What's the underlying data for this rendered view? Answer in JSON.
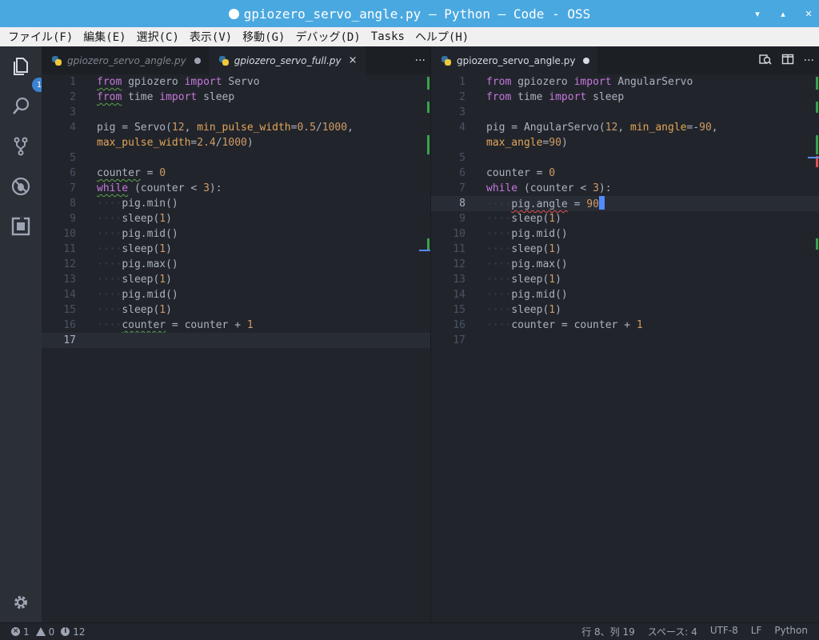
{
  "window": {
    "title": "gpiozero_servo_angle.py — Python — Code - OSS",
    "controls": [
      "▾",
      "▴",
      "✕"
    ]
  },
  "menu": [
    "ファイル(F)",
    "編集(E)",
    "選択(C)",
    "表示(V)",
    "移動(G)",
    "デバッグ(D)",
    "Tasks",
    "ヘルプ(H)"
  ],
  "activity": {
    "explorer_badge": "1"
  },
  "left_group": {
    "tabs": [
      {
        "label": "gpiozero_servo_angle.py",
        "dirty": true
      },
      {
        "label": "gpiozero_servo_full.py",
        "close": "×"
      }
    ],
    "more": "···",
    "line_numbers": [
      "1",
      "2",
      "3",
      "4",
      "",
      "5",
      "6",
      "7",
      "8",
      "9",
      "10",
      "11",
      "12",
      "13",
      "14",
      "15",
      "16",
      "17"
    ]
  },
  "right_group": {
    "tabs": [
      {
        "label": "gpiozero_servo_angle.py",
        "dirty": true
      }
    ],
    "more": "···",
    "line_numbers": [
      "1",
      "2",
      "3",
      "4",
      "",
      "5",
      "6",
      "7",
      "8",
      "9",
      "10",
      "11",
      "12",
      "13",
      "14",
      "15",
      "16",
      "17"
    ]
  },
  "status": {
    "errors": "1",
    "warnings": "0",
    "infos": "12",
    "position": "行 8、列 19",
    "spaces": "スペース: 4",
    "encoding": "UTF-8",
    "eol": "LF",
    "language": "Python"
  },
  "colors": {
    "titlebar": "#4aa8e0",
    "keyword": "#c678dd",
    "number": "#d19a66",
    "accent": "#3b82d0"
  }
}
